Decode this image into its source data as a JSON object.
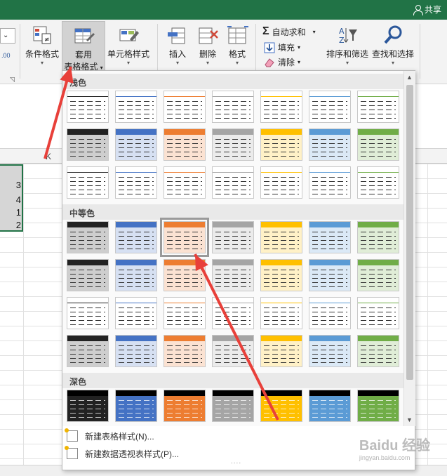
{
  "titlebar": {
    "share_label": "共享"
  },
  "ribbon": {
    "left_number": ".00",
    "conditional_format": "条件格式",
    "table_style_line1": "套用",
    "table_style_line2": "表格格式",
    "cell_style": "单元格样式",
    "insert": "插入",
    "delete": "删除",
    "format": "格式",
    "autosum": "自动求和",
    "fill": "填充",
    "clear": "清除",
    "sort_filter": "排序和筛选",
    "find_select": "查找和选择"
  },
  "sheet": {
    "column_label": "K",
    "cells": [
      "3",
      "4",
      "1",
      "2"
    ]
  },
  "gallery": {
    "sections": [
      "浅色",
      "中等色",
      "深色"
    ],
    "colors": [
      "#222222",
      "#4472c4",
      "#ed7d31",
      "#a5a5a5",
      "#ffc000",
      "#5b9bd5",
      "#70ad47"
    ],
    "new_table_style": "新建表格样式(N)...",
    "new_pivot_style": "新建数据透视表样式(P)...",
    "grip": "...."
  },
  "watermark": {
    "brand": "Baidu 经验",
    "url": "jingyan.baidu.com"
  },
  "annotation_color": "#e8403a"
}
